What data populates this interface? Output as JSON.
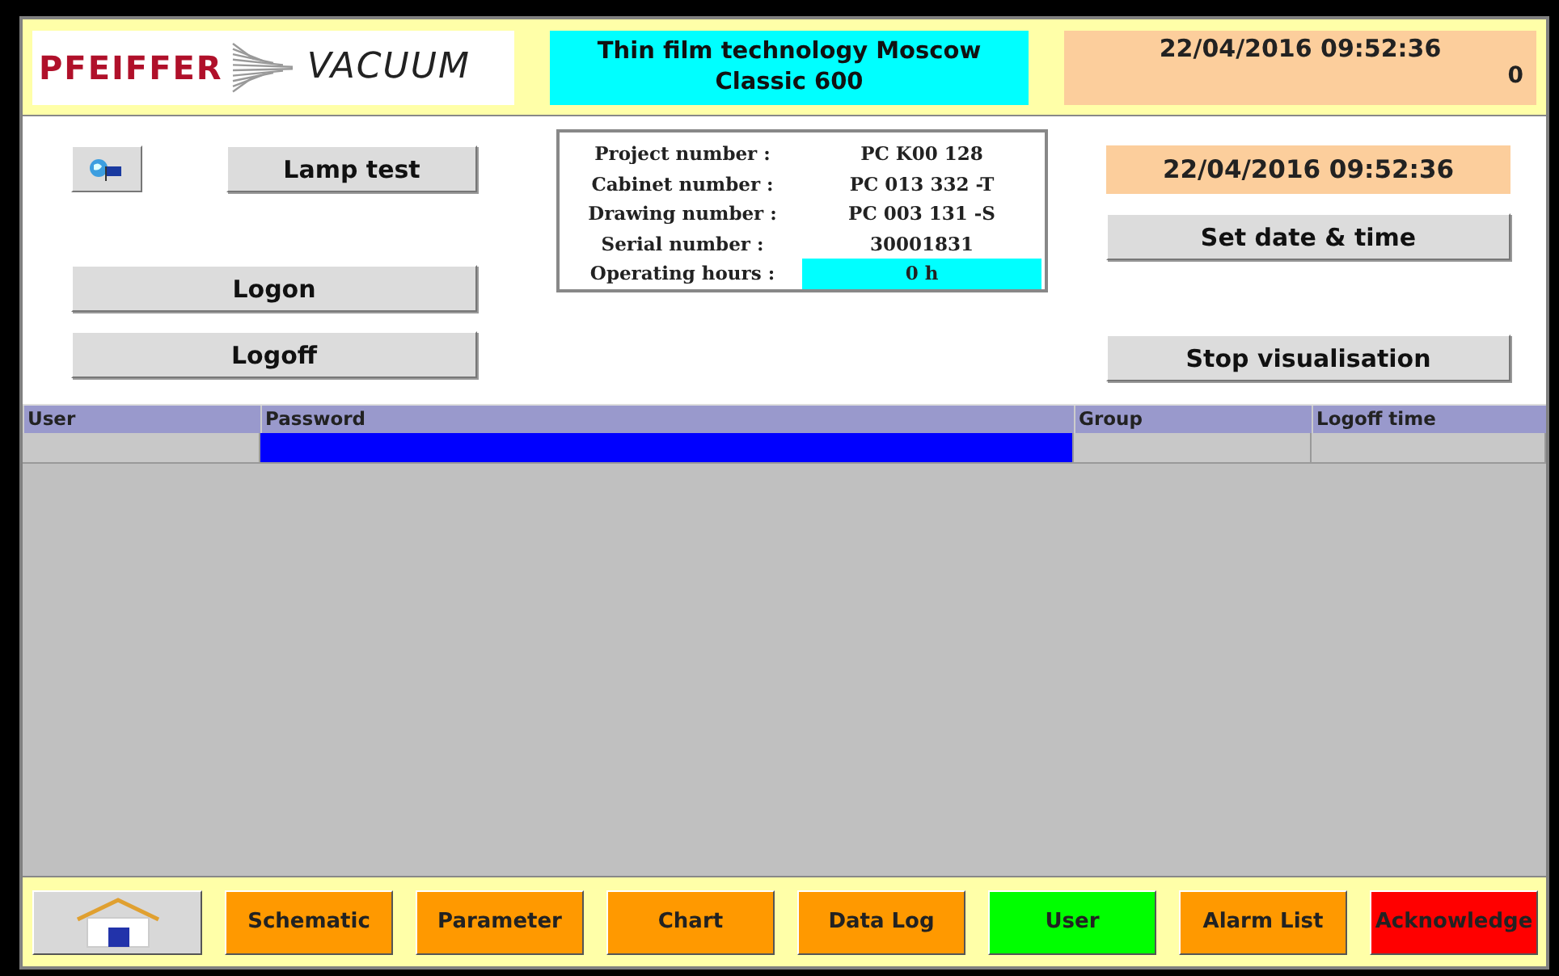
{
  "header": {
    "logo": {
      "left": "PFEIFFER",
      "right": "VACUUM"
    },
    "title": [
      "Thin film technology Moscow",
      "Classic 600"
    ],
    "datetime": "22/04/2016 09:52:36",
    "counter": "0"
  },
  "left_buttons": {
    "language": {
      "kind": "icon"
    },
    "lamp_test": "Lamp test",
    "logon": "Logon",
    "logoff": "Logoff"
  },
  "info": [
    {
      "label": "Project number :",
      "value": "PC K00 128",
      "highlight": false
    },
    {
      "label": "Cabinet number :",
      "value": "PC 013 332 -T",
      "highlight": false
    },
    {
      "label": "Drawing number :",
      "value": "PC 003 131 -S",
      "highlight": false
    },
    {
      "label": "Serial number :",
      "value": "30001831",
      "highlight": false
    },
    {
      "label": "Operating hours :",
      "value": "0 h",
      "highlight": true
    }
  ],
  "right": {
    "datetime": "22/04/2016 09:52:36",
    "set_button": "Set date & time",
    "stop_button": "Stop visualisation"
  },
  "table": {
    "columns": [
      "User",
      "Password",
      "Group",
      "Logoff time"
    ],
    "input_row": [
      {
        "selected": false
      },
      {
        "selected": true
      },
      {
        "selected": false
      },
      {
        "selected": false
      }
    ]
  },
  "nav": [
    {
      "kind": "home",
      "color": "#d8d8d8"
    },
    {
      "kind": "text",
      "label": "Schematic",
      "color": "#ff9900"
    },
    {
      "kind": "text",
      "label": "Parameter",
      "color": "#ff9900"
    },
    {
      "kind": "text",
      "label": "Chart",
      "color": "#ff9900"
    },
    {
      "kind": "text",
      "label": "Data Log",
      "color": "#ff9900"
    },
    {
      "kind": "text",
      "label": "User",
      "color": "#00ff00"
    },
    {
      "kind": "text",
      "label": "Alarm List",
      "color": "#ff9900"
    },
    {
      "kind": "text",
      "label": "Acknowledge",
      "color": "#ff0000"
    }
  ]
}
